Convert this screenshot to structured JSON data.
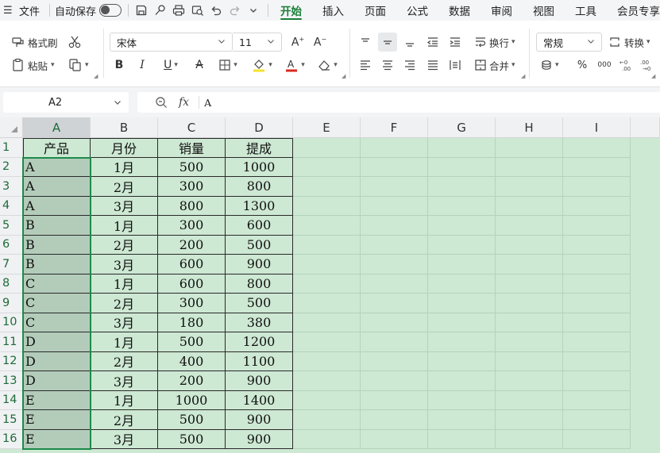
{
  "menubar": {
    "menu_icon": "☰",
    "file_label": "文件",
    "autosave_label": "自动保存",
    "tabs": [
      "开始",
      "插入",
      "页面",
      "公式",
      "数据",
      "审阅",
      "视图",
      "工具",
      "会员专享"
    ],
    "active_tab": "开始"
  },
  "ribbon": {
    "format_painter": "格式刷",
    "paste": "粘贴",
    "font_name": "宋体",
    "font_size": "11",
    "wrap_text": "换行",
    "merge": "合并",
    "number_format": "常规",
    "convert": "转换"
  },
  "formula_bar": {
    "name_box": "A2",
    "fx_label": "fx",
    "content": "A"
  },
  "sheet": {
    "columns": [
      "A",
      "B",
      "C",
      "D",
      "E",
      "F",
      "G",
      "H",
      "I"
    ],
    "rows": [
      "1",
      "2",
      "3",
      "4",
      "5",
      "6",
      "7",
      "8",
      "9",
      "10",
      "11",
      "12",
      "13",
      "14",
      "15",
      "16"
    ],
    "header": [
      "产品",
      "月份",
      "销量",
      "提成"
    ],
    "data": [
      [
        "A",
        "1月",
        "500",
        "1000"
      ],
      [
        "A",
        "2月",
        "300",
        "800"
      ],
      [
        "A",
        "3月",
        "800",
        "1300"
      ],
      [
        "B",
        "1月",
        "300",
        "600"
      ],
      [
        "B",
        "2月",
        "200",
        "500"
      ],
      [
        "B",
        "3月",
        "600",
        "900"
      ],
      [
        "C",
        "1月",
        "600",
        "800"
      ],
      [
        "C",
        "2月",
        "300",
        "500"
      ],
      [
        "C",
        "3月",
        "180",
        "380"
      ],
      [
        "D",
        "1月",
        "500",
        "1200"
      ],
      [
        "D",
        "2月",
        "400",
        "1100"
      ],
      [
        "D",
        "3月",
        "200",
        "900"
      ],
      [
        "E",
        "1月",
        "1000",
        "1400"
      ],
      [
        "E",
        "2月",
        "500",
        "900"
      ],
      [
        "E",
        "3月",
        "500",
        "900"
      ]
    ]
  },
  "colors": {
    "accent": "#1a7f37",
    "sheet_highlight": "#cde8d3",
    "selected_column": "#b3ccba"
  }
}
